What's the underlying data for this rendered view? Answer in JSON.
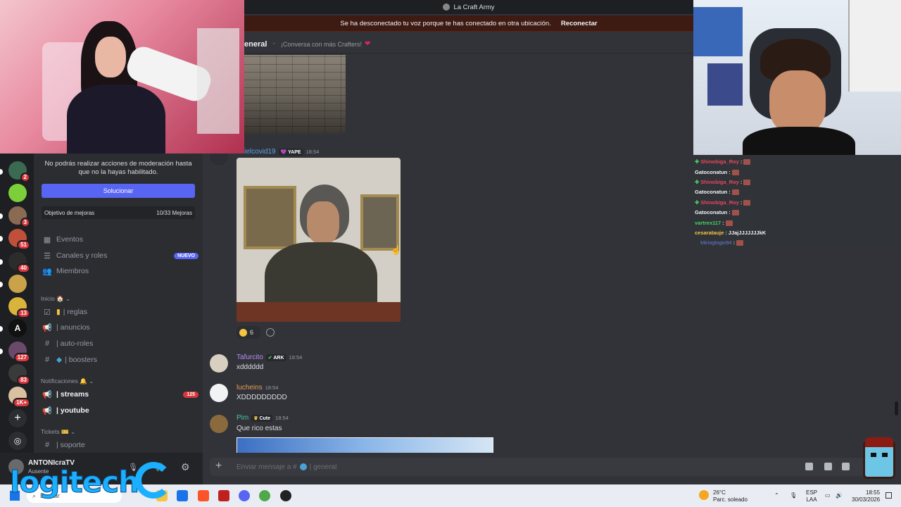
{
  "window": {
    "title": "La Craft Army"
  },
  "notice": {
    "text": "Se ha desconectado tu voz porque te has conectado en otra ubicación.",
    "action": "Reconectar"
  },
  "channel_header": {
    "name": "eneral",
    "topic": "¡Conversa con más Crafters!"
  },
  "sidebar": {
    "mod_notice": "No podrás realizar acciones de moderación hasta que no la hayas habilitado.",
    "solve_button": "Solucionar",
    "boost_goal": {
      "label": "Objetivo de mejoras",
      "value": "10/33 Mejoras"
    },
    "nav": [
      {
        "label": "Eventos"
      },
      {
        "label": "Canales y roles",
        "badge": "NUEVO"
      },
      {
        "label": "Miembros"
      }
    ],
    "categories": [
      {
        "label": "Inicio 🏠"
      },
      {
        "label": "Notificaciones 🔔"
      },
      {
        "label": "Tickets 🎫"
      }
    ],
    "channels": [
      {
        "label": "| reglas"
      },
      {
        "label": "| anuncios"
      },
      {
        "label": "| auto-roles"
      },
      {
        "label": "| boosters"
      },
      {
        "label": "| streams",
        "badge": "125"
      },
      {
        "label": "| youtube"
      },
      {
        "label": "| soporte"
      }
    ]
  },
  "servers": [
    {
      "badge": "2"
    },
    {
      "badge": ""
    },
    {
      "badge": "3"
    },
    {
      "badge": "51"
    },
    {
      "badge": "40"
    },
    {
      "badge": ""
    },
    {
      "badge": "13"
    },
    {
      "badge": ""
    },
    {
      "badge": "127"
    },
    {
      "badge": "83"
    },
    {
      "badge": "1K+"
    }
  ],
  "messages": [
    {
      "author": "anielcovid19",
      "tag": "YAPE",
      "time": "18:54",
      "color": "#5ea1e6",
      "reaction_count": "6"
    },
    {
      "author": "Tafurcito",
      "tag": "ARK",
      "time": "18:54",
      "text": "xdddddd",
      "color": "#b58df5"
    },
    {
      "author": "lucheins",
      "tag": "",
      "time": "18:54",
      "text": "XDDDDDDDDD",
      "color": "#e89c57"
    },
    {
      "author": "Pim",
      "tag": "Cute",
      "time": "18:54",
      "text": "Que rico estas",
      "color": "#4fc3a1"
    }
  ],
  "input": {
    "placeholder": "Enviar mensaje a #",
    "channel": "| general"
  },
  "user": {
    "name": "ANTONIcraTV",
    "status": "Ausente"
  },
  "twitch_chat": [
    {
      "name": "Shinobiga_Roy",
      "color": "#e94560",
      "text": ""
    },
    {
      "name": "Gatoconatun",
      "color": "#f2f3f5",
      "text": ""
    },
    {
      "name": "Shinobiga_Roy",
      "color": "#e94560",
      "text": ""
    },
    {
      "name": "Gatoconatun",
      "color": "#f2f3f5",
      "text": ""
    },
    {
      "name": "Shinobiga_Roy",
      "color": "#e94560",
      "text": ""
    },
    {
      "name": "Gatoconatun",
      "color": "#f2f3f5",
      "text": ""
    },
    {
      "name": "vartrex117",
      "color": "#46d160",
      "text": ""
    },
    {
      "name": "cesaratauje",
      "color": "#f5c542",
      "text": "JJajJJJJJJJkK"
    },
    {
      "name": "Mirioglogio94",
      "color": "#6c7bd6",
      "text": ""
    }
  ],
  "overlay": {
    "logo": "logitech"
  },
  "taskbar": {
    "search": "Buscar",
    "weather": {
      "temp": "26°C",
      "desc": "Parc. soleado"
    },
    "lang": {
      "line1": "ESP",
      "line2": "LAA"
    },
    "clock": {
      "time": "18:55",
      "date": "30/03/2026"
    }
  },
  "colors": {
    "accent": "#5865f2",
    "danger": "#da373c"
  }
}
